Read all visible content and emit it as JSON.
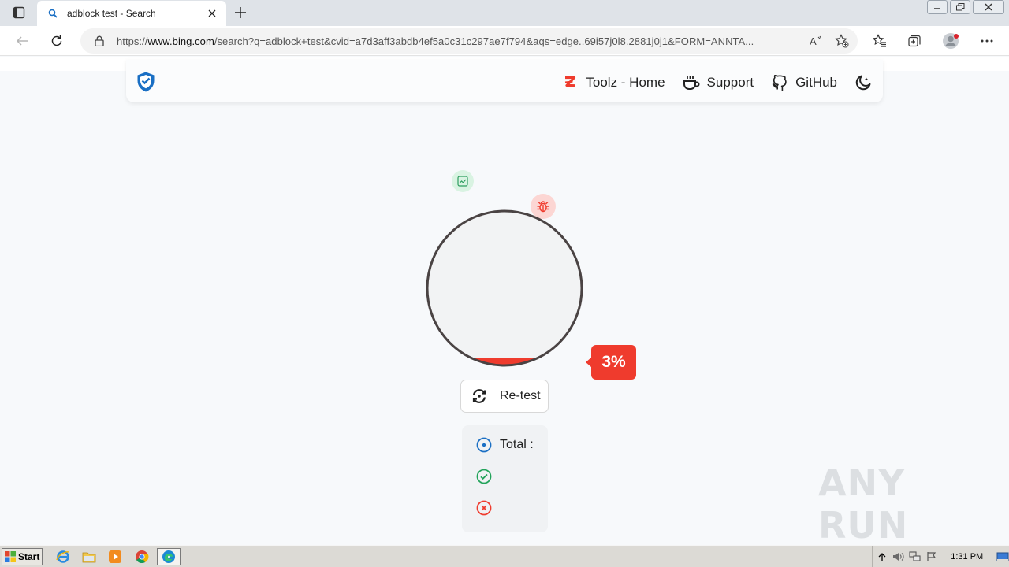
{
  "browser": {
    "tab_title": "adblock test - Search",
    "url_prefix": "https://",
    "url_host": "www.bing.com",
    "url_rest": "/search?q=adblock+test&cvid=a7d3aff3abdb4ef5a0c31c297ae7f794&aqs=edge..69i57j0l8.2881j0j1&FORM=ANNTA...",
    "read_aloud_label": "A"
  },
  "site": {
    "nav": [
      {
        "label": "Toolz - Home"
      },
      {
        "label": "Support"
      },
      {
        "label": "GitHub"
      }
    ]
  },
  "test": {
    "percent_label": "3%",
    "percent_value": 0.03,
    "retest_label": "Re-test",
    "total_label": "Total :",
    "accent_red": "#ef3b2d",
    "accent_green": "#22a35a",
    "accent_blue": "#1a6fc4"
  },
  "watermark": "ANY RUN",
  "taskbar": {
    "start_label": "Start",
    "clock": "1:31 PM",
    "apps": [
      "ie-icon",
      "folder-icon",
      "media-player-icon",
      "chrome-icon",
      "edge-icon"
    ]
  }
}
